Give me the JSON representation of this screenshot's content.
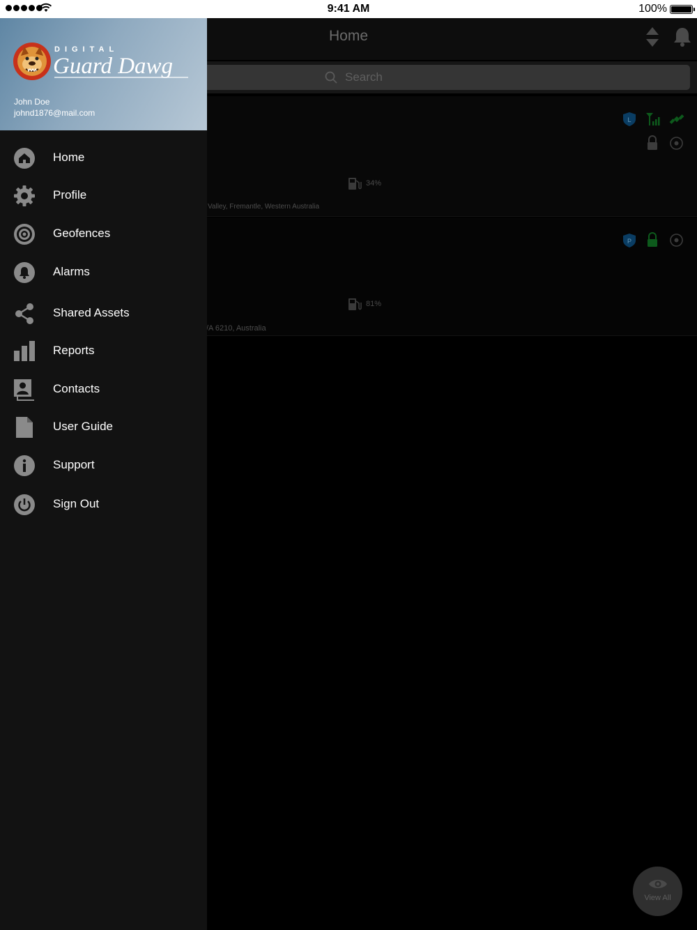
{
  "status_bar": {
    "time": "9:41 AM",
    "battery": "100%"
  },
  "navbar": {
    "title": "Home"
  },
  "search": {
    "placeholder": "Search"
  },
  "assets": [
    {
      "fuel": "34%",
      "address": "Valley, Fremantle, Western Australia",
      "badge": "L"
    },
    {
      "fuel": "81%",
      "address": "/A 6210, Australia",
      "badge": "P"
    }
  ],
  "view_all": {
    "label": "View All"
  },
  "drawer": {
    "logo_text_top": "DIGITAL",
    "logo_text_main": "Guard Dawg",
    "user_name": "John Doe",
    "user_email": "johnd1876@mail.com",
    "menu": [
      {
        "label": "Home",
        "icon": "home-icon"
      },
      {
        "label": "Profile",
        "icon": "gear-icon"
      },
      {
        "label": "Geofences",
        "icon": "geofence-icon"
      },
      {
        "label": "Alarms",
        "icon": "bell-icon"
      },
      {
        "label": "Shared Assets",
        "icon": "share-icon"
      },
      {
        "label": "Reports",
        "icon": "bar-chart-icon"
      },
      {
        "label": "Contacts",
        "icon": "contacts-icon"
      },
      {
        "label": "User Guide",
        "icon": "document-icon"
      },
      {
        "label": "Support",
        "icon": "info-icon"
      },
      {
        "label": "Sign Out",
        "icon": "power-icon"
      }
    ]
  },
  "colors": {
    "accent_blue": "#0a4c7a",
    "accent_green": "#0c6a1e",
    "drawer_bg": "#121212"
  }
}
